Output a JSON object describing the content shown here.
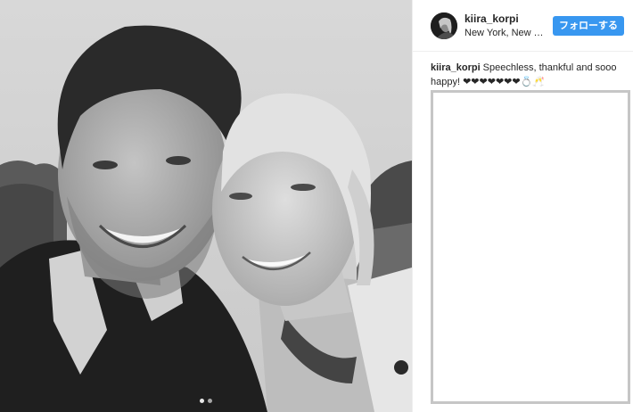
{
  "post": {
    "user": {
      "username": "kiira_korpi",
      "location": "New York, New Y...",
      "avatar_icon": "profile-photo"
    },
    "follow_button": {
      "label": "フォローする",
      "color": "#3897f0"
    },
    "caption": {
      "username": "kiira_korpi",
      "text": "Speechless, thankful and sooo happy! ❤❤❤❤❤❤❤💍🥂"
    },
    "carousel": {
      "total": 2,
      "current": 1
    },
    "photo": {
      "description_icon": "photo-black-and-white-selfie",
      "tone": "grayscale"
    }
  }
}
